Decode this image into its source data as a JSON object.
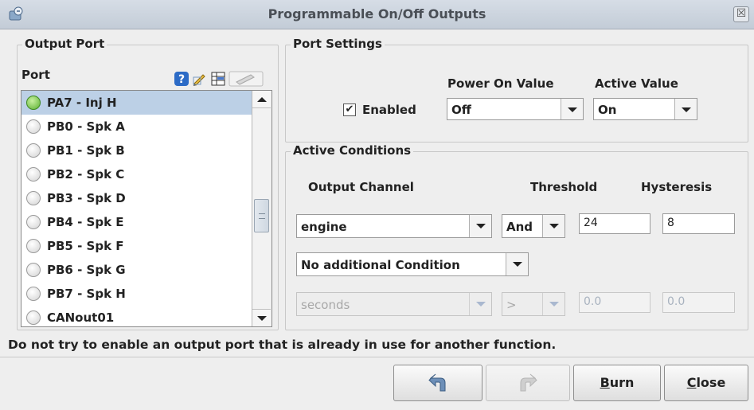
{
  "window": {
    "title": "Programmable On/Off Outputs",
    "close_glyph": "☒"
  },
  "output_port": {
    "legend": "Output Port",
    "port_label": "Port",
    "toolbar_icons": [
      "help-icon",
      "edit-icon",
      "table-icon",
      "pencil-disabled-icon"
    ],
    "items": [
      {
        "label": "PA7 - Inj H",
        "active": true,
        "selected": true
      },
      {
        "label": "PB0 - Spk A",
        "active": false,
        "selected": false
      },
      {
        "label": "PB1 - Spk B",
        "active": false,
        "selected": false
      },
      {
        "label": "PB2 - Spk C",
        "active": false,
        "selected": false
      },
      {
        "label": "PB3 - Spk D",
        "active": false,
        "selected": false
      },
      {
        "label": "PB4 - Spk E",
        "active": false,
        "selected": false
      },
      {
        "label": "PB5 - Spk F",
        "active": false,
        "selected": false
      },
      {
        "label": "PB6 - Spk G",
        "active": false,
        "selected": false
      },
      {
        "label": "PB7 - Spk H",
        "active": false,
        "selected": false
      },
      {
        "label": "CANout01",
        "active": false,
        "selected": false
      }
    ]
  },
  "port_settings": {
    "legend": "Port Settings",
    "enabled_label": "Enabled",
    "enabled_checked": true,
    "power_on_header": "Power On Value",
    "power_on_value": "Off",
    "active_header": "Active Value",
    "active_value": "On"
  },
  "active_conditions": {
    "legend": "Active Conditions",
    "col_output_channel": "Output Channel",
    "col_threshold": "Threshold",
    "col_hysteresis": "Hysteresis",
    "row1": {
      "channel": "engine",
      "operator": "And",
      "threshold": "24",
      "hysteresis": "8"
    },
    "additional": "No additional Condition",
    "row2": {
      "channel": "seconds",
      "operator": ">",
      "threshold": "0.0",
      "hysteresis": "0.0"
    }
  },
  "warning": "Do not try to enable an output port that is already in use for another function.",
  "buttons": {
    "undo_icon": "undo-arrow-icon",
    "redo_icon": "redo-arrow-icon",
    "burn_mnemonic": "B",
    "burn_rest": "urn",
    "close_mnemonic": "C",
    "close_rest": "lose"
  },
  "colors": {
    "selection": "#bcd0e6",
    "active_led": "#5bb030",
    "titlebar": "#c3ccd7"
  }
}
